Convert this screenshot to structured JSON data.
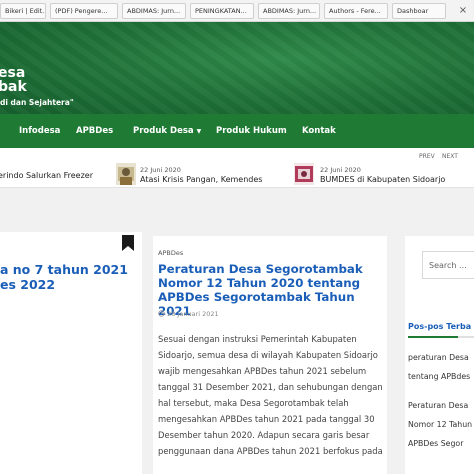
{
  "browser": {
    "bookmarks": [
      "Bikeri | Edit...",
      "(PDF) Pengere...",
      "ABDIMAS: Jurn...",
      "PENINGKATAN...",
      "ABDIMAS: Jurn...",
      "Authors - Fere...",
      "Dashboar"
    ],
    "close_label": "×"
  },
  "header": {
    "title_line1": "esa",
    "title_line2": "bak",
    "tagline": "di dan Sejahtera\""
  },
  "nav": {
    "items": [
      {
        "label": "Infodesa"
      },
      {
        "label": "APBDes"
      },
      {
        "label": "Produk Desa"
      },
      {
        "label": "Produk Hukum"
      },
      {
        "label": "Kontak"
      }
    ],
    "caret": "▼"
  },
  "ticker": {
    "prev": "PREV",
    "next": "NEXT",
    "items": [
      {
        "text": "erindo Salurkan Freezer",
        "date": ""
      },
      {
        "text": "Atasi Krisis Pangan, Kemendes",
        "date": "22 Juni 2020"
      },
      {
        "text": "BUMDES di Kabupaten Sidoarjo",
        "date": "22 Juni 2020"
      }
    ]
  },
  "left_post": {
    "title_line1": "a no 7 tahun 2021",
    "title_line2": "es 2022"
  },
  "main_post": {
    "category": "APBDes",
    "title": "Peraturan Desa Segorotambak Nomor 12 Tahun 2020 tentang APBDes Segorotambak Tahun 2021",
    "date": "28 Januari 2021",
    "body": "Sesuai dengan instruksi Pemerintah Kabupaten Sidoarjo, semua desa di wilayah Kabupaten Sidoarjo wajib mengesahkan APBDes tahun 2021 sebelum tanggal 31 Desember 2021, dan sehubungan dengan hal tersebut, maka Desa Segorotambak telah mengesahkan APBDes tahun 2021 pada tanggal 30 Desember tahun 2020. Adapun secara garis besar penggunaan dana APBDes tahun 2021 berfokus pada"
  },
  "sidebar": {
    "search_placeholder": "Search ...",
    "heading": "Pos-pos Terba",
    "links": [
      "peraturan Desa",
      "tentang APBdes",
      "Peraturan Desa",
      "Nomor 12 Tahun",
      "APBDes Segor"
    ]
  },
  "colors": {
    "nav_green": "#1f7a34",
    "link_blue": "#1a5eb8"
  }
}
